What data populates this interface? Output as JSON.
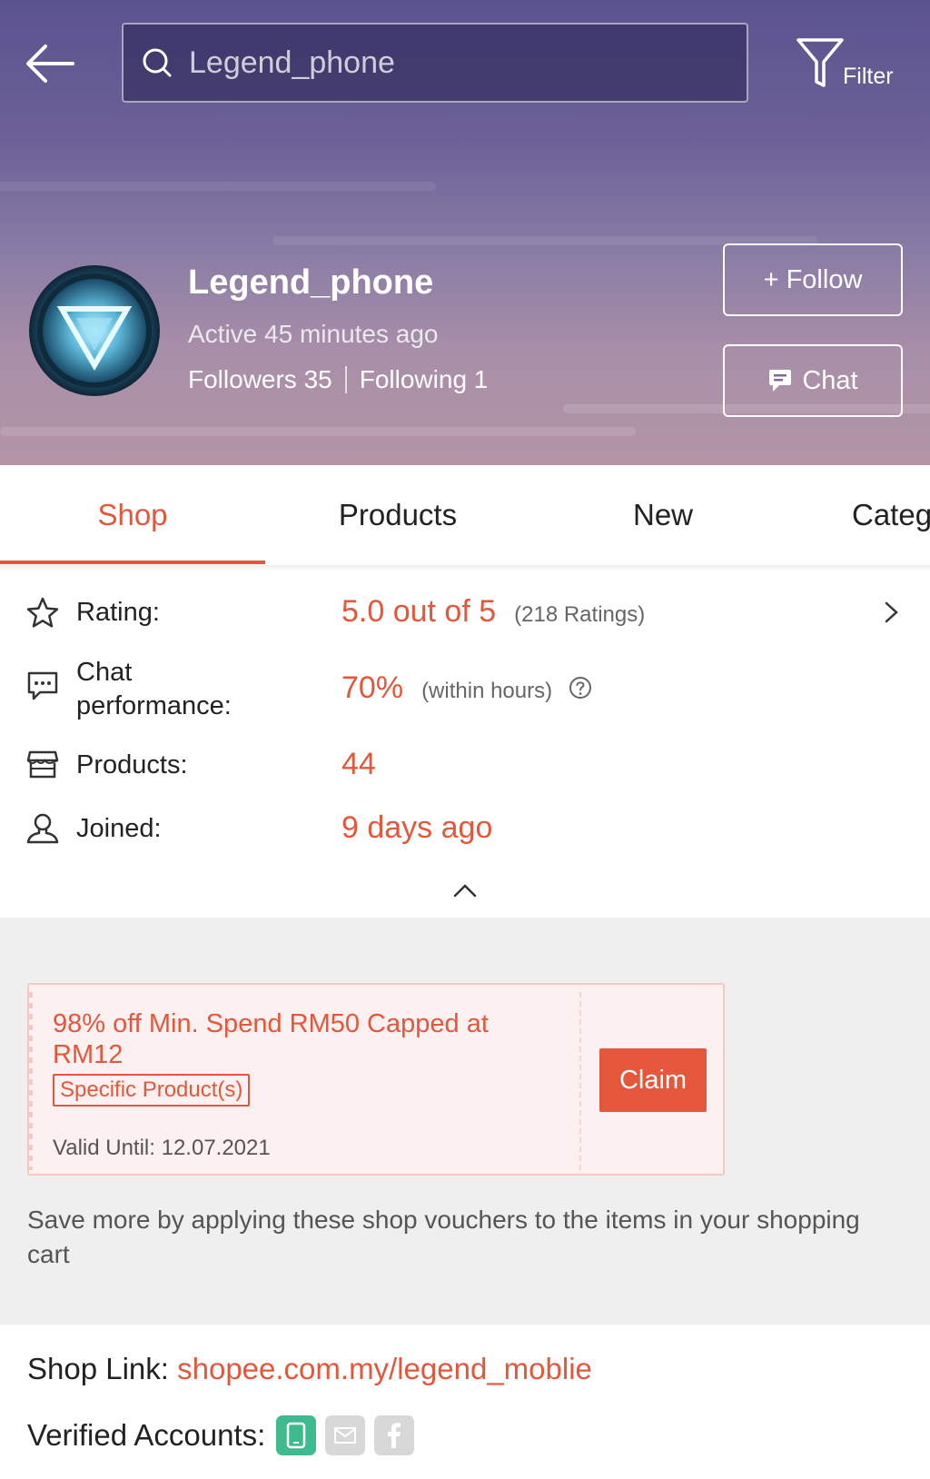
{
  "header": {
    "search_placeholder": "Legend_phone",
    "filter_label": "Filter"
  },
  "shop": {
    "name": "Legend_phone",
    "active_status": "Active 45 minutes ago",
    "followers_label": "Followers 35",
    "following_label": "Following 1",
    "follow_button": "+ Follow",
    "chat_button": "Chat"
  },
  "tabs": [
    {
      "label": "Shop",
      "active": true
    },
    {
      "label": "Products",
      "active": false
    },
    {
      "label": "New",
      "active": false
    },
    {
      "label": "Categ",
      "active": false
    }
  ],
  "stats": {
    "rating_label": "Rating:",
    "rating_value": "5.0 out of 5",
    "rating_note": "(218 Ratings)",
    "chat_label_line1": "Chat",
    "chat_label_line2": "performance:",
    "chat_value": "70%",
    "chat_note": "(within hours)",
    "products_label": "Products:",
    "products_value": "44",
    "joined_label": "Joined:",
    "joined_value": "9 days ago"
  },
  "voucher": {
    "title": "98% off Min. Spend RM50 Capped at RM12",
    "tag": "Specific Product(s)",
    "valid_until": "Valid Until: 12.07.2021",
    "claim_button": "Claim"
  },
  "save_more_text": "Save more by applying these shop vouchers to the items in your shopping cart",
  "footer": {
    "shop_link_label": "Shop Link:",
    "shop_link_value": "shopee.com.my/legend_moblie",
    "verified_label": "Verified Accounts:",
    "verified": [
      {
        "icon": "phone-icon",
        "verified": true
      },
      {
        "icon": "email-icon",
        "verified": false
      },
      {
        "icon": "facebook-icon",
        "verified": false
      }
    ]
  },
  "colors": {
    "accent": "#e4573a",
    "verified_green": "#3fba8d"
  }
}
